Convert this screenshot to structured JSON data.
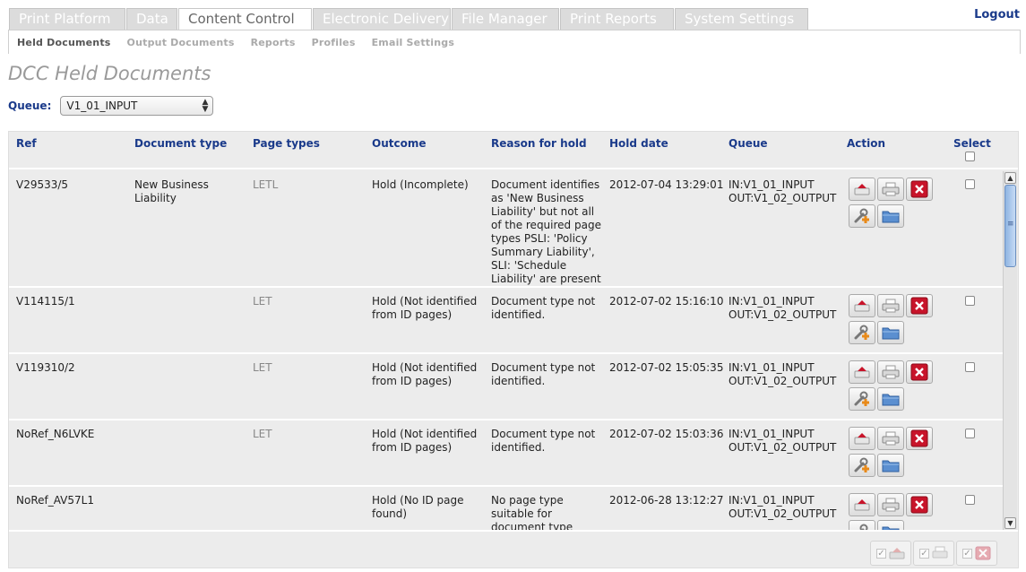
{
  "nav": {
    "tabs": [
      {
        "label": "Print Platform"
      },
      {
        "label": "Data"
      },
      {
        "label": "Content Control"
      },
      {
        "label": "Electronic Delivery"
      },
      {
        "label": "File Manager"
      },
      {
        "label": "Print Reports"
      },
      {
        "label": "System Settings"
      }
    ],
    "active_tab": "Content Control",
    "logout": "Logout"
  },
  "subnav": {
    "items": [
      {
        "label": "Held Documents"
      },
      {
        "label": "Output Documents"
      },
      {
        "label": "Reports"
      },
      {
        "label": "Profiles"
      },
      {
        "label": "Email Settings"
      }
    ],
    "active": "Held Documents"
  },
  "page": {
    "title": "DCC Held Documents",
    "queue_label": "Queue:",
    "queue_value": "V1_01_INPUT"
  },
  "table": {
    "headers": {
      "ref": "Ref",
      "doc_type": "Document type",
      "page_types": "Page types",
      "outcome": "Outcome",
      "reason": "Reason for hold",
      "hold_date": "Hold date",
      "queue": "Queue",
      "action": "Action",
      "select": "Select"
    },
    "rows": [
      {
        "ref": "V29533/5",
        "doc_type": "New Business Liability",
        "page_types": "LETL",
        "outcome": "Hold (Incomplete)",
        "reason": "Document identifies as 'New Business Liability' but not all of the required page types PSLI: 'Policy Summary Liability', SLI: 'Schedule Liability' are present",
        "hold_date": "2012-07-04 13:29:01",
        "queue_in": "IN:V1_01_INPUT",
        "queue_out": "OUT:V1_02_OUTPUT"
      },
      {
        "ref": "V114115/1",
        "doc_type": "",
        "page_types": "LET",
        "outcome": "Hold (Not identified from ID pages)",
        "reason": "Document type not identified.",
        "hold_date": "2012-07-02 15:16:10",
        "queue_in": "IN:V1_01_INPUT",
        "queue_out": "OUT:V1_02_OUTPUT"
      },
      {
        "ref": "V119310/2",
        "doc_type": "",
        "page_types": "LET",
        "outcome": "Hold (Not identified from ID pages)",
        "reason": "Document type not identified.",
        "hold_date": "2012-07-02 15:05:35",
        "queue_in": "IN:V1_01_INPUT",
        "queue_out": "OUT:V1_02_OUTPUT"
      },
      {
        "ref": "NoRef_N6LVKE",
        "doc_type": "",
        "page_types": "LET",
        "outcome": "Hold (Not identified from ID pages)",
        "reason": "Document type not identified.",
        "hold_date": "2012-07-02 15:03:36",
        "queue_in": "IN:V1_01_INPUT",
        "queue_out": "OUT:V1_02_OUTPUT"
      },
      {
        "ref": "NoRef_AV57L1",
        "doc_type": "",
        "page_types": "",
        "outcome": "Hold (No ID page found)",
        "reason": "No page type suitable for document type",
        "hold_date": "2012-06-28 13:12:27",
        "queue_in": "IN:V1_01_INPUT",
        "queue_out": "OUT:V1_02_OUTPUT"
      }
    ]
  },
  "icons": {
    "release": "release-icon",
    "print": "print-icon",
    "delete": "delete-icon",
    "edit": "wrench-add-icon",
    "open": "folder-icon"
  },
  "colors": {
    "link_blue": "#1a3a8a",
    "delete_red": "#c8142a",
    "grid_bg": "#ececec"
  }
}
